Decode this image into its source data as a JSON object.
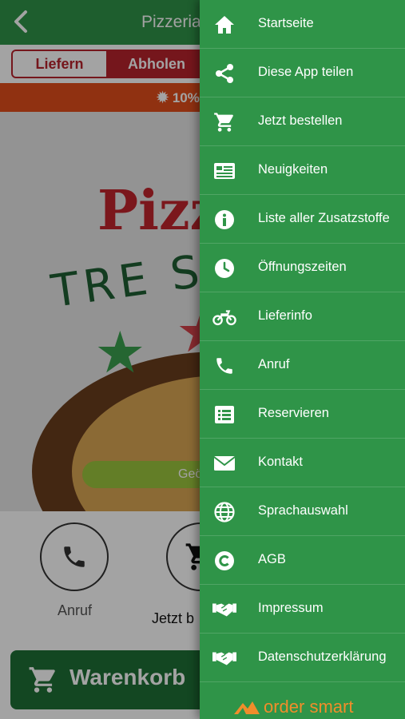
{
  "app": {
    "title": "Pizzeria",
    "toggle": {
      "deliver": "Liefern",
      "pickup": "Abholen"
    },
    "promo": "10%",
    "hero": {
      "logo_line1": "Pizz",
      "logo_line2": "TRE S",
      "status": "Geö"
    },
    "quick_actions": [
      {
        "label": "Anruf",
        "icon": "phone-icon"
      },
      {
        "label": "Jetzt b",
        "icon": "cart-icon"
      }
    ],
    "cart_button": "Warenkorb",
    "colors": {
      "primary": "#2f9448",
      "accent": "#b8232c",
      "promo": "#e14e1c",
      "cart": "#1f6f36",
      "brand": "#f08d2b"
    }
  },
  "drawer": {
    "items": [
      {
        "label": "Startseite",
        "icon": "home-icon"
      },
      {
        "label": "Diese App teilen",
        "icon": "share-icon"
      },
      {
        "label": "Jetzt bestellen",
        "icon": "cart-icon"
      },
      {
        "label": "Neuigkeiten",
        "icon": "news-icon"
      },
      {
        "label": "Liste aller Zusatzstoffe",
        "icon": "info-icon"
      },
      {
        "label": "Öffnungszeiten",
        "icon": "clock-icon"
      },
      {
        "label": "Lieferinfo",
        "icon": "motorcycle-icon"
      },
      {
        "label": "Anruf",
        "icon": "phone-icon"
      },
      {
        "label": "Reservieren",
        "icon": "list-icon"
      },
      {
        "label": "Kontakt",
        "icon": "mail-icon"
      },
      {
        "label": "Sprachauswahl",
        "icon": "globe-icon"
      },
      {
        "label": "AGB",
        "icon": "copyright-icon"
      },
      {
        "label": "Impressum",
        "icon": "handshake-icon"
      },
      {
        "label": "Datenschutzerklärung",
        "icon": "handshake-icon"
      }
    ],
    "brand": "order smart"
  }
}
